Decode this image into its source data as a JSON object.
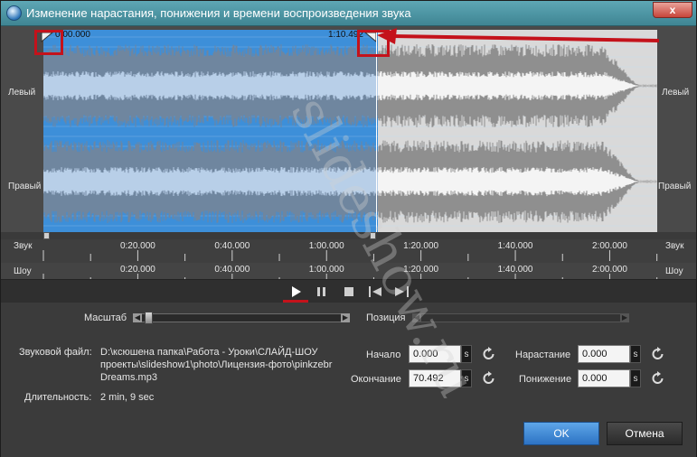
{
  "window": {
    "title": "Изменение нарастания, понижения и времени воспроизведения звука",
    "close_glyph": "x"
  },
  "waveform": {
    "channel_left": "Левый",
    "channel_right": "Правый",
    "start_time": "0:00.000",
    "cursor_time": "1:10.492",
    "selection_fraction": 0.545
  },
  "ruler_sound": {
    "label": "Звук",
    "ticks": [
      "0:20.000",
      "0:40.000",
      "1:00.000",
      "1:20.000",
      "1:40.000",
      "2:00.000"
    ]
  },
  "ruler_show": {
    "label": "Шоу",
    "ticks": [
      "0:20.000",
      "0:40.000",
      "1:00.000",
      "1:20.000",
      "1:40.000",
      "2:00.000"
    ]
  },
  "controls": {
    "scale_label": "Масштаб",
    "position_label": "Позиция"
  },
  "file": {
    "label": "Звуковой файл:",
    "path_line1": "D:\\ксюшена папка\\Работа - Уроки\\СЛАЙД-ШОУ",
    "path_line2": "проекты\\slideshow1\\photo\\Лицензия-фото\\pinkzebr",
    "path_line3": "Dreams.mp3",
    "duration_label": "Длительность:",
    "duration_value": "2 min, 9 sec"
  },
  "timing": {
    "start_label": "Начало",
    "start_value": "0.000",
    "end_label": "Окончание",
    "end_value": "70.492",
    "fade_in_label": "Нарастание",
    "fade_in_value": "0.000",
    "fade_out_label": "Понижение",
    "fade_out_value": "0.000",
    "unit": "s"
  },
  "buttons": {
    "ok": "OK",
    "cancel": "Отмена"
  },
  "watermark": "slideshow.ru",
  "colors": {
    "selection": "#4a9be0",
    "annotation": "#c4121b",
    "ok_button": "#2d73c4"
  }
}
